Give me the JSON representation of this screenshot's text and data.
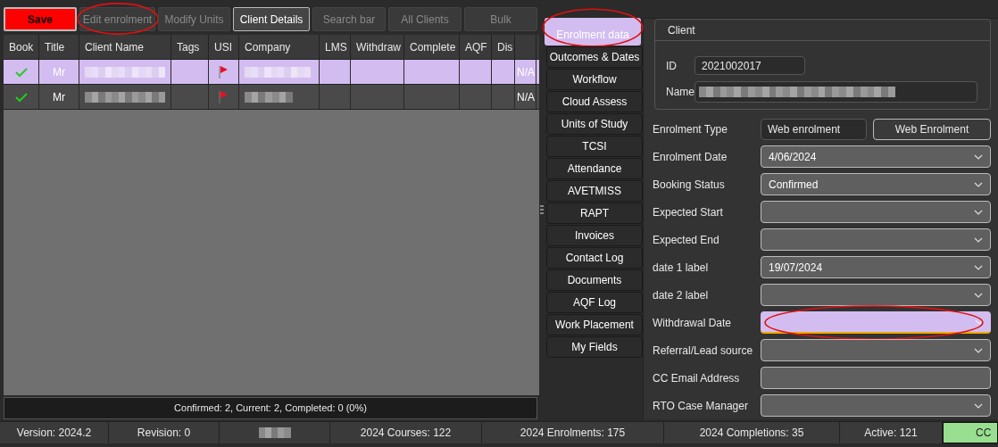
{
  "toolbar": [
    {
      "label": "Save",
      "kind": "primary",
      "circled": false
    },
    {
      "label": "Edit enrolment",
      "kind": "disabled",
      "circled": true
    },
    {
      "label": "Modify Units",
      "kind": "disabled",
      "circled": false
    },
    {
      "label": "Client Details",
      "kind": "normal",
      "circled": false
    },
    {
      "label": "Search bar",
      "kind": "disabled",
      "circled": false
    },
    {
      "label": "All Clients",
      "kind": "disabled",
      "circled": false
    },
    {
      "label": "Bulk",
      "kind": "disabled",
      "circled": false
    }
  ],
  "table": {
    "columns": [
      "Book",
      "Title",
      "Client Name",
      "Tags",
      "USI",
      "Company",
      "LMS",
      "Withdraw",
      "Complete",
      "AQF",
      "Dis"
    ],
    "rows": [
      {
        "selected": true,
        "booked": true,
        "title": "Mr",
        "usi_flag": true,
        "column_12": "N/A"
      },
      {
        "selected": false,
        "booked": true,
        "title": "Mr",
        "usi_flag": true,
        "column_12": "N/A"
      }
    ]
  },
  "summary": "Confirmed: 2, Current: 2, Completed: 0 (0%)",
  "tabs": [
    {
      "label": "Enrolment data",
      "selected": true,
      "circled": true
    },
    {
      "label": "Outcomes & Dates",
      "selected": false,
      "circled": false
    },
    {
      "label": "Workflow",
      "selected": false,
      "circled": false
    },
    {
      "label": "Cloud Assess",
      "selected": false,
      "circled": false
    },
    {
      "label": "Units of Study",
      "selected": false,
      "circled": false
    },
    {
      "label": "TCSI",
      "selected": false,
      "circled": false
    },
    {
      "label": "Attendance",
      "selected": false,
      "circled": false
    },
    {
      "label": "AVETMISS",
      "selected": false,
      "circled": false
    },
    {
      "label": "RAPT",
      "selected": false,
      "circled": false
    },
    {
      "label": "Invoices",
      "selected": false,
      "circled": false
    },
    {
      "label": "Contact Log",
      "selected": false,
      "circled": false
    },
    {
      "label": "Documents",
      "selected": false,
      "circled": false
    },
    {
      "label": "AQF Log",
      "selected": false,
      "circled": false
    },
    {
      "label": "Work Placement",
      "selected": false,
      "circled": false
    },
    {
      "label": "My Fields",
      "selected": false,
      "circled": false
    }
  ],
  "client": {
    "title": "Client",
    "id_label": "ID",
    "id": "2021002017",
    "name_label": "Name"
  },
  "fields": [
    {
      "label": "Enrolment Type",
      "kind": "text_button",
      "value": "Web enrolment",
      "button": "Web Enrolment"
    },
    {
      "label": "Enrolment Date",
      "kind": "dropdown",
      "value": "4/06/2024"
    },
    {
      "label": "Booking Status",
      "kind": "dropdown",
      "value": "Confirmed"
    },
    {
      "label": "Expected Start",
      "kind": "dropdown"
    },
    {
      "label": "Expected End",
      "kind": "dropdown"
    },
    {
      "label": "date 1 label",
      "kind": "dropdown",
      "value": "19/07/2024"
    },
    {
      "label": "date 2 label",
      "kind": "dropdown"
    },
    {
      "label": "Withdrawal Date",
      "kind": "dropdown",
      "highlighted": true,
      "circled": true
    },
    {
      "label": "Referral/Lead source",
      "kind": "dropdown"
    },
    {
      "label": "CC Email Address",
      "kind": "input"
    },
    {
      "label": "RTO Case Manager",
      "kind": "dropdown"
    }
  ],
  "status_bar": [
    {
      "kind": "text",
      "text": "Version: 2024.2"
    },
    {
      "kind": "text",
      "text": "Revision: 0"
    },
    {
      "kind": "redacted"
    },
    {
      "kind": "text",
      "text": "2024 Courses: 122"
    },
    {
      "kind": "text",
      "text": "2024 Enrolments: 175"
    },
    {
      "kind": "text",
      "text": "2024 Completions: 35"
    },
    {
      "kind": "text",
      "text": "Active: 121"
    },
    {
      "kind": "ok",
      "text": "CC"
    }
  ]
}
